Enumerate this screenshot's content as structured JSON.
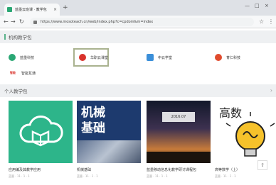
{
  "browser": {
    "tab_title": "蓝墨云班课 · 教学包",
    "tab_close": "×",
    "new_tab": "+",
    "url": "https://www.mosoteach.cn/web/index.php?c=cpdom&m=index",
    "star": "☆",
    "menu": "⋮",
    "window_controls": [
      "—",
      "□",
      "×"
    ]
  },
  "sections": {
    "org": "机构教学包",
    "personal": "个人教学包",
    "personal_arrow": "›"
  },
  "orgs": [
    {
      "label": "蓝墨科技",
      "icon": "mosoink-logo-icon",
      "color": "#2aa774"
    },
    {
      "label": "华职云课堂",
      "icon": "huazhi-logo-icon",
      "color": "#d9322b"
    },
    {
      "label": "中云学堂",
      "icon": "zhongyun-logo-icon",
      "color": "#3b8fd9"
    },
    {
      "label": "育仁科技",
      "icon": "yuren-logo-icon",
      "color": "#e04b2d"
    },
    {
      "label": "智能互通",
      "icon": "zhineng-logo-icon",
      "color": "#d9322b",
      "badge": "智能"
    }
  ],
  "cards": [
    {
      "title": "应用编及其教学应用",
      "meta": "蓝墨 · 11 · 1 · 1"
    },
    {
      "title": "机械基础",
      "meta": "蓝墨 · 11 · 1 · 1",
      "cover_text": "机械\n基础"
    },
    {
      "title": "蓝墨移动信息化教学研讨课程包",
      "meta": "蓝墨 · 11 · 1 · 1",
      "cover_text": "2016.07"
    },
    {
      "title": "高等数学（上）",
      "meta": "蓝墨 · 11 · 1 · 1",
      "cover_text": "高数"
    }
  ],
  "scroll_top": "⇧"
}
